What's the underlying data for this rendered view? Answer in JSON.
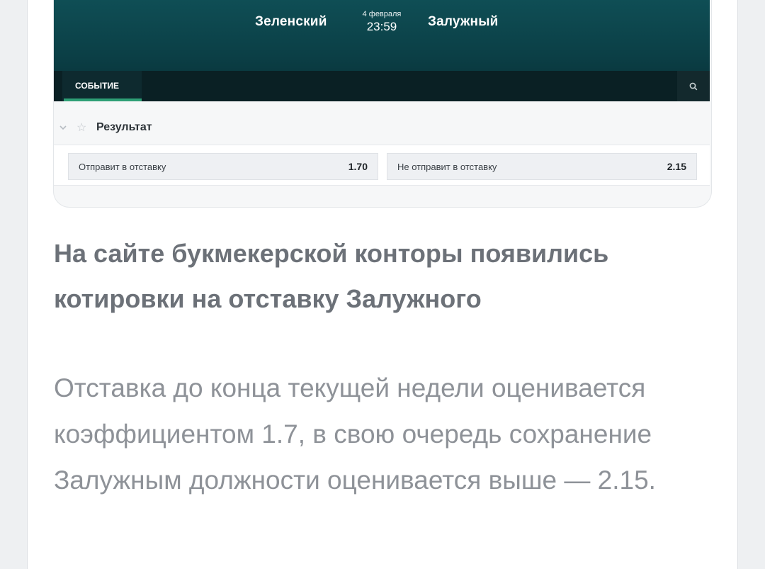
{
  "screenshot": {
    "match": {
      "team_left": "Зеленский",
      "team_right": "Залужный",
      "date": "4 февраля",
      "time": "23:59"
    },
    "tabs": {
      "active": "СОБЫТИЕ"
    },
    "market": {
      "title": "Результат",
      "outcomes": [
        {
          "label": "Отправит в отставку",
          "odds": "1.70"
        },
        {
          "label": "Не отправит в отставку",
          "odds": "2.15"
        }
      ]
    }
  },
  "article": {
    "headline": "На сайте букмекерской конторы появились котировки на отставку Залужного",
    "paragraph": "Отставка до конца текущей недели оценивается коэффициентом 1.7, в свою очередь сохранение Залужным должности оценивается выше — 2.15."
  },
  "colors": {
    "banner": "#0b3f46",
    "tab_accent": "#2e9f76",
    "headline": "#6c7178",
    "paragraph": "#8e9298"
  }
}
